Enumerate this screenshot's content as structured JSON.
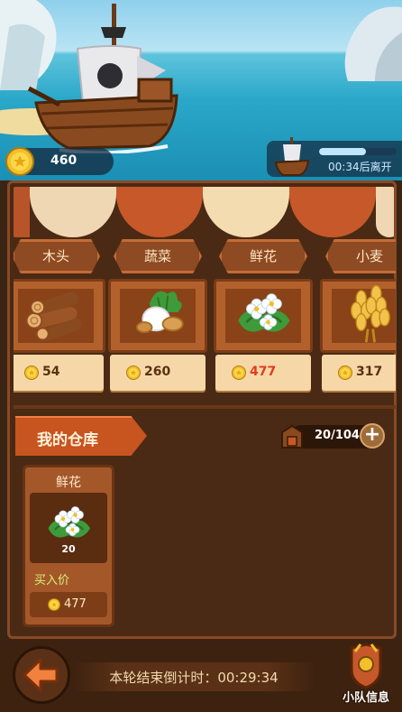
{
  "top": {
    "coins": "460",
    "departure_text": "00:34后离开",
    "departure_progress": 0.6
  },
  "market": {
    "stalls": [
      {
        "name": "木头",
        "good_icon": "wood-logs-icon",
        "price": "54",
        "price_color": "#5a3011"
      },
      {
        "name": "蔬菜",
        "good_icon": "vegetable-icon",
        "price": "260",
        "price_color": "#5a3011"
      },
      {
        "name": "鲜花",
        "good_icon": "flower-icon",
        "price": "477",
        "price_color": "#e23a1f"
      },
      {
        "name": "小麦",
        "good_icon": "wheat-icon",
        "price": "317",
        "price_color": "#5a3011"
      }
    ]
  },
  "warehouse": {
    "title": "我的仓库",
    "capacity": "20/104",
    "items": [
      {
        "name": "鲜花",
        "quantity": "20",
        "buy_label": "买入价",
        "buy_price": "477"
      }
    ]
  },
  "bottom": {
    "countdown": "本轮结束倒计时：00:29:34",
    "team_label": "小队信息"
  },
  "colors": {
    "coin": "#f2c02b",
    "accent": "#c8541f",
    "price_highlight": "#e23a1f"
  }
}
